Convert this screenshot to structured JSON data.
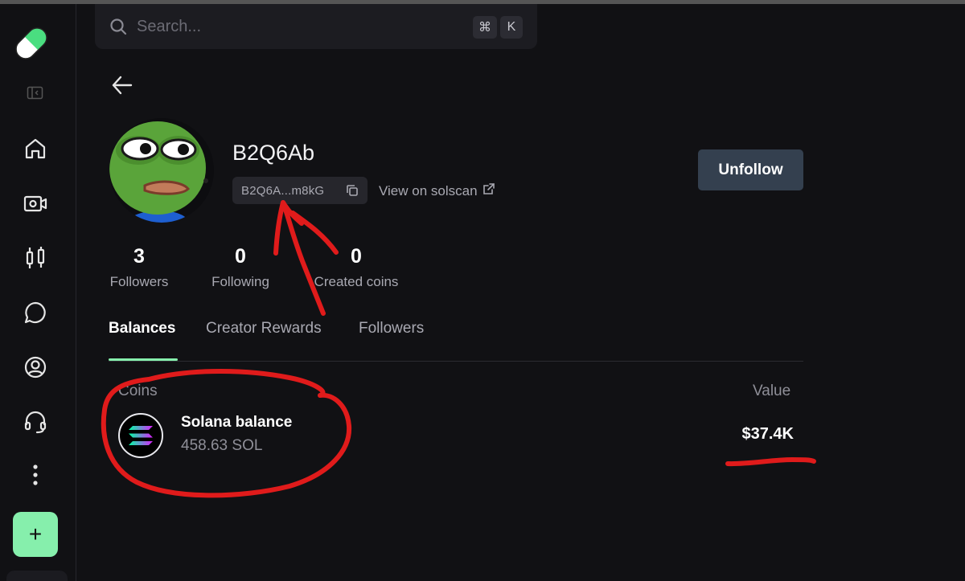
{
  "search": {
    "placeholder": "Search...",
    "shortcut_keys": [
      "⌘",
      "K"
    ]
  },
  "sidebar": {
    "items": [
      {
        "icon": "home-icon"
      },
      {
        "icon": "video-camera-icon"
      },
      {
        "icon": "candlestick-chart-icon"
      },
      {
        "icon": "chat-bubble-icon"
      },
      {
        "icon": "user-circle-icon"
      },
      {
        "icon": "headset-icon"
      },
      {
        "icon": "more-vertical-icon"
      }
    ],
    "add_label": "+"
  },
  "profile": {
    "username": "B2Q6Ab",
    "address_short": "B2Q6A...m8kG",
    "solscan_label": "View on solscan",
    "unfollow_label": "Unfollow"
  },
  "stats": [
    {
      "value": "3",
      "label": "Followers"
    },
    {
      "value": "0",
      "label": "Following"
    },
    {
      "value": "0",
      "label": "Created coins"
    }
  ],
  "tabs": [
    {
      "label": "Balances",
      "active": true
    },
    {
      "label": "Creator Rewards",
      "active": false
    },
    {
      "label": "Followers",
      "active": false
    }
  ],
  "balances": {
    "col_coins": "Coins",
    "col_value": "Value",
    "rows": [
      {
        "name": "Solana balance",
        "amount": "458.63 SOL",
        "value": "$37.4K"
      }
    ]
  },
  "colors": {
    "accent": "#86efac",
    "background": "#111114",
    "button": "#34404f",
    "annotation": "#e01b1b"
  }
}
